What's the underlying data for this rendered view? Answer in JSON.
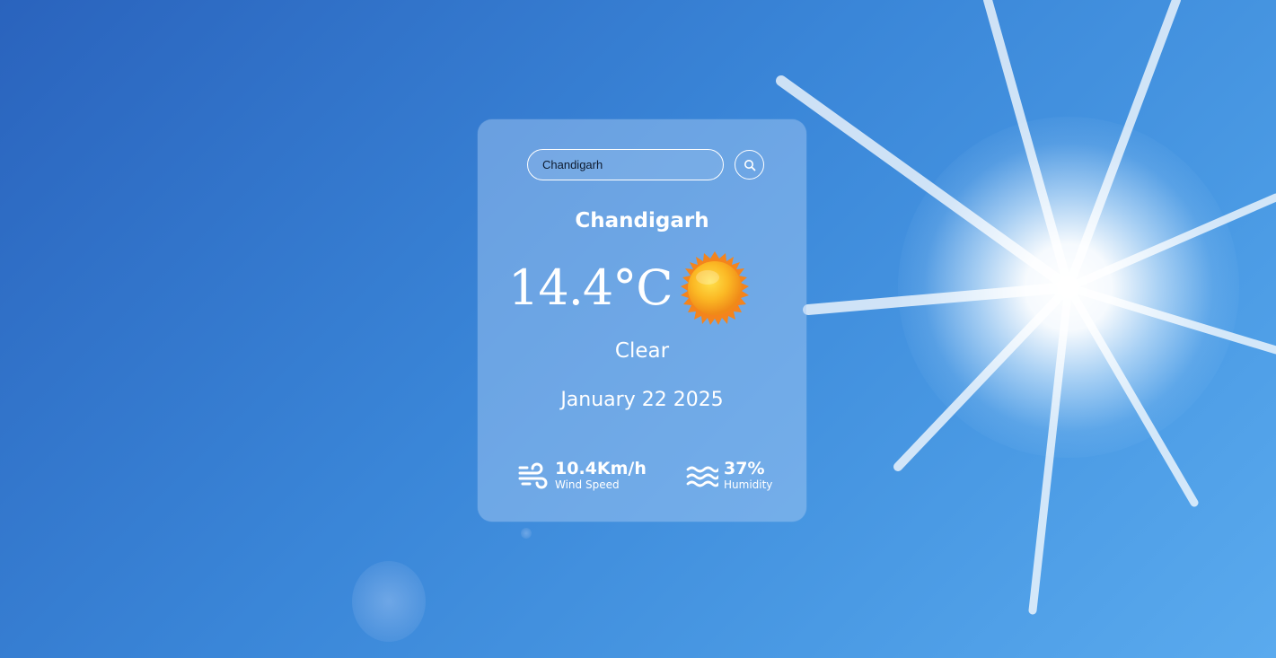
{
  "search": {
    "value": "Chandigarh",
    "button_icon": "search-icon"
  },
  "weather": {
    "city": "Chandigarh",
    "temperature": "14.4°C",
    "icon": "sun-icon",
    "condition": "Clear",
    "date": "January 22 2025"
  },
  "details": {
    "wind": {
      "icon": "wind-icon",
      "value": "10.4Km/h",
      "label": "Wind Speed"
    },
    "humidity": {
      "icon": "humidity-icon",
      "value": "37%",
      "label": "Humidity"
    }
  },
  "colors": {
    "background": "#3a86d8",
    "card": "#aacdf5",
    "text": "#ffffff",
    "sun": "#f7a21b"
  }
}
